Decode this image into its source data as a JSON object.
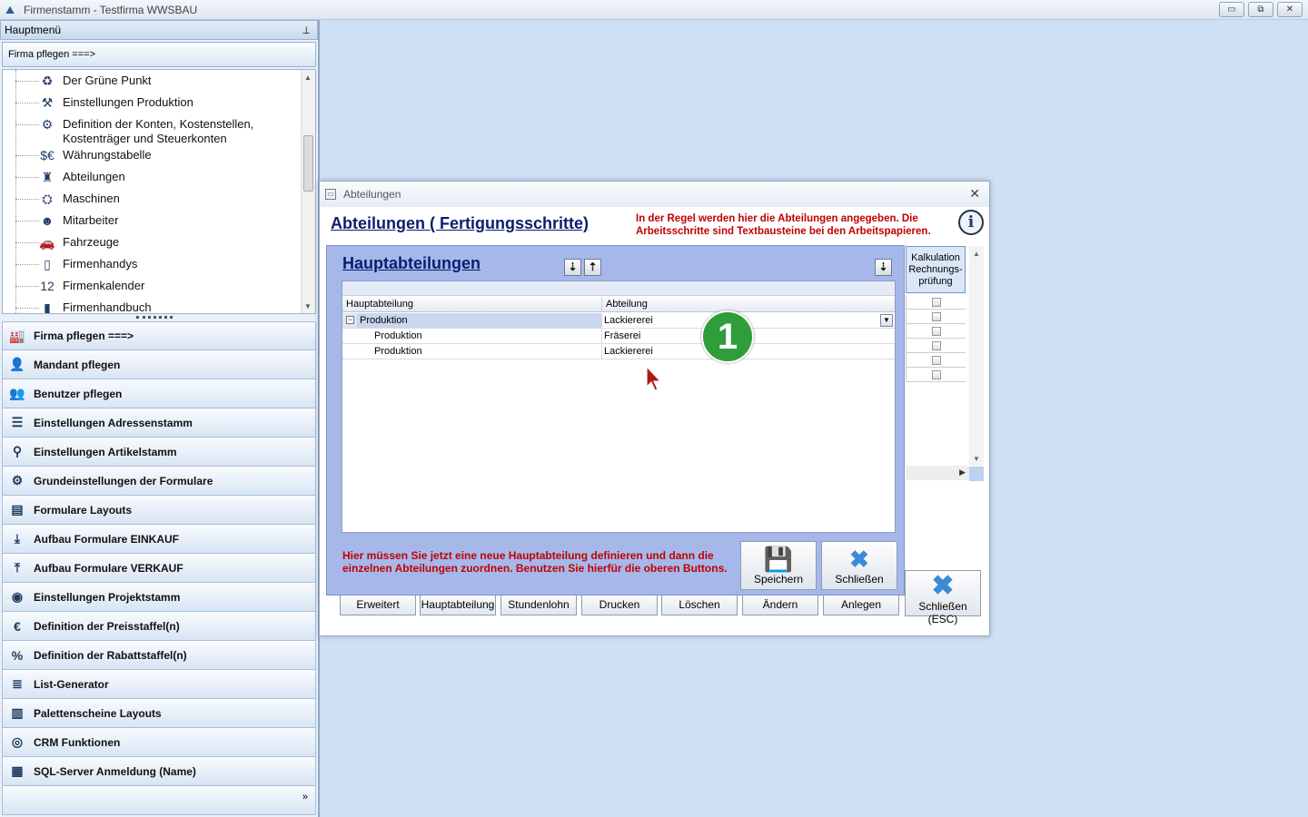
{
  "window": {
    "title": "Firmenstamm - Testfirma WWSBAU",
    "minimize": "▭",
    "restore": "⧉",
    "close": "✕"
  },
  "sidebar": {
    "header": "Hauptmenü",
    "pin": "⊥",
    "current_section": "Firma pflegen    ===>",
    "tree_items": [
      {
        "label": "Der Grüne Punkt",
        "icon": "recycle-icon",
        "glyph": "♻"
      },
      {
        "label": "Einstellungen Produktion",
        "icon": "tools-icon",
        "glyph": "⚒"
      },
      {
        "label": "Definition der Konten, Kostenstellen,",
        "label2": "Kostenträger und Steuerkonten",
        "icon": "accounts-icon",
        "glyph": "⚙"
      },
      {
        "label": "Währungstabelle",
        "icon": "currency-icon",
        "glyph": "$€"
      },
      {
        "label": "Abteilungen",
        "icon": "departments-icon",
        "glyph": "♜"
      },
      {
        "label": "Maschinen",
        "icon": "machines-icon",
        "glyph": "⛭"
      },
      {
        "label": "Mitarbeiter",
        "icon": "employee-icon",
        "glyph": "☻"
      },
      {
        "label": "Fahrzeuge",
        "icon": "car-icon",
        "glyph": "🚗"
      },
      {
        "label": "Firmenhandys",
        "icon": "phone-icon",
        "glyph": "▯"
      },
      {
        "label": "Firmenkalender",
        "icon": "calendar-icon",
        "glyph": "12"
      },
      {
        "label": "Firmenhandbuch",
        "icon": "book-icon",
        "glyph": "▮"
      }
    ],
    "menu_items": [
      {
        "label": "Firma pflegen    ===>",
        "icon": "factory-icon",
        "glyph": "🏭"
      },
      {
        "label": "Mandant pflegen",
        "icon": "client-icon",
        "glyph": "👤"
      },
      {
        "label": "Benutzer pflegen",
        "icon": "users-icon",
        "glyph": "👥"
      },
      {
        "label": "Einstellungen Adressenstamm",
        "icon": "address-icon",
        "glyph": "☰"
      },
      {
        "label": "Einstellungen Artikelstamm",
        "icon": "article-icon",
        "glyph": "⚲"
      },
      {
        "label": "Grundeinstellungen der Formulare",
        "icon": "form-settings-icon",
        "glyph": "⚙"
      },
      {
        "label": "Formulare Layouts",
        "icon": "form-layout-icon",
        "glyph": "▤"
      },
      {
        "label": "Aufbau Formulare EINKAUF",
        "icon": "download-icon",
        "glyph": "⤓"
      },
      {
        "label": "Aufbau Formulare VERKAUF",
        "icon": "upload-icon",
        "glyph": "⤒"
      },
      {
        "label": "Einstellungen Projektstamm",
        "icon": "project-icon",
        "glyph": "◉"
      },
      {
        "label": "Definition der Preisstaffel(n)",
        "icon": "price-icon",
        "glyph": "€"
      },
      {
        "label": "Definition der Rabattstaffel(n)",
        "icon": "discount-icon",
        "glyph": "%"
      },
      {
        "label": "List-Generator",
        "icon": "list-icon",
        "glyph": "≣"
      },
      {
        "label": "Palettenscheine Layouts",
        "icon": "pallet-icon",
        "glyph": "▥"
      },
      {
        "label": "CRM Funktionen",
        "icon": "crm-icon",
        "glyph": "◎"
      },
      {
        "label": "SQL-Server Anmeldung (Name)",
        "icon": "sql-server-icon",
        "glyph": "▦"
      }
    ],
    "footer_chevron": "»"
  },
  "dialog_back": {
    "title": "Abteilungen",
    "heading": "Abteilungen ( Fertigungsschritte)",
    "note": "In der Regel werden hier die Abteilungen angegeben. Die Arbeitsschritte sind Textbausteine bei den Arbeitspapieren.",
    "info_glyph": "i",
    "kalk_header": "Kalkulation Rechnungs-prüfung",
    "buttons": [
      "Erweitert",
      "Hauptabteilung",
      "Stundenlohn",
      "Drucken",
      "Löschen",
      "Ändern",
      "Anlegen"
    ],
    "close_esc_label": "Schließen (ESC)"
  },
  "dialog_front": {
    "heading": "Hauptabteilungen",
    "columns": [
      "Hauptabteilung",
      "Abteilung"
    ],
    "group_row": {
      "hauptabteilung": "Produktion",
      "abteilung": "Lackiererei"
    },
    "rows": [
      {
        "hauptabteilung": "Produktion",
        "abteilung": "Fräserei"
      },
      {
        "hauptabteilung": "Produktion",
        "abteilung": "Lackiererei"
      }
    ],
    "note": "Hier müssen Sie jetzt eine neue Hauptabteilung definieren und dann die einzelnen Abteilungen zuordnen. Benutzen Sie hierfür die oberen Buttons.",
    "save_label": "Speichern",
    "close_label": "Schließen"
  },
  "step_marker": "1"
}
